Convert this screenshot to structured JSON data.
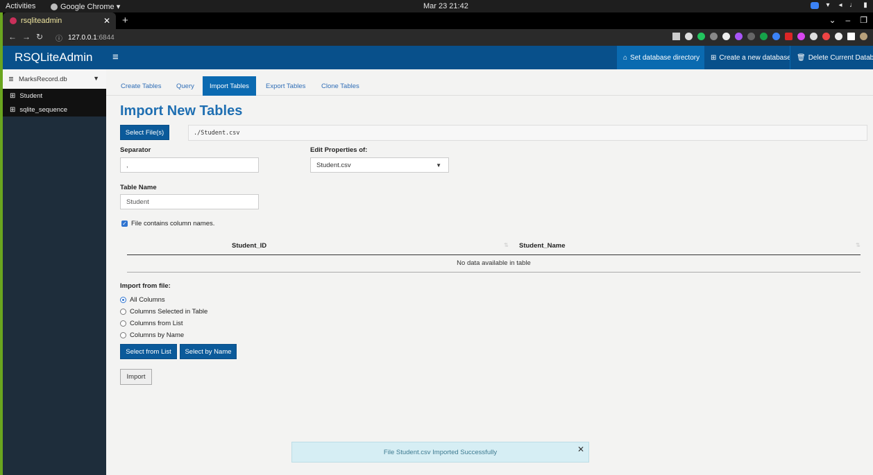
{
  "os": {
    "activities": "Activities",
    "app_name": "Google Chrome ▾",
    "clock": "Mar 23  21:42"
  },
  "browser": {
    "tab_title": "rsqliteadmin",
    "url_host": "127.0.0.1",
    "url_port": ":6844"
  },
  "app": {
    "logo": "RSQLiteAdmin",
    "header_buttons": [
      {
        "label": "Set database directory",
        "icon": "home-icon"
      },
      {
        "label": "Create a new database",
        "icon": "plus-square-icon"
      },
      {
        "label": "Delete Current Databas",
        "icon": "trash-icon"
      }
    ],
    "sidebar": {
      "db_name": "MarksRecord.db",
      "tables": [
        "Student",
        "sqlite_sequence"
      ]
    },
    "tabs": [
      "Create Tables",
      "Query",
      "Import Tables",
      "Export Tables",
      "Clone Tables"
    ],
    "active_tab": "Import Tables",
    "import": {
      "heading": "Import New Tables",
      "select_files_label": "Select File(s)",
      "file_path": "./Student.csv",
      "separator_label": "Separator",
      "separator_value": ",",
      "edit_props_label": "Edit Properties of:",
      "edit_props_value": "Student.csv",
      "table_name_label": "Table Name",
      "table_name_value": "Student",
      "checkbox_label": "File contains column names.",
      "columns": [
        "Student_ID",
        "Student_Name"
      ],
      "empty_message": "No data available in table",
      "import_from_label": "Import from file:",
      "radio_options": [
        "All Columns",
        "Columns Selected in Table",
        "Columns from List",
        "Columns by Name"
      ],
      "selected_option": "All Columns",
      "select_from_list_label": "Select from List",
      "select_by_name_label": "Select by Name",
      "import_button_label": "Import"
    },
    "notification": "File Student.csv Imported Successfully"
  }
}
